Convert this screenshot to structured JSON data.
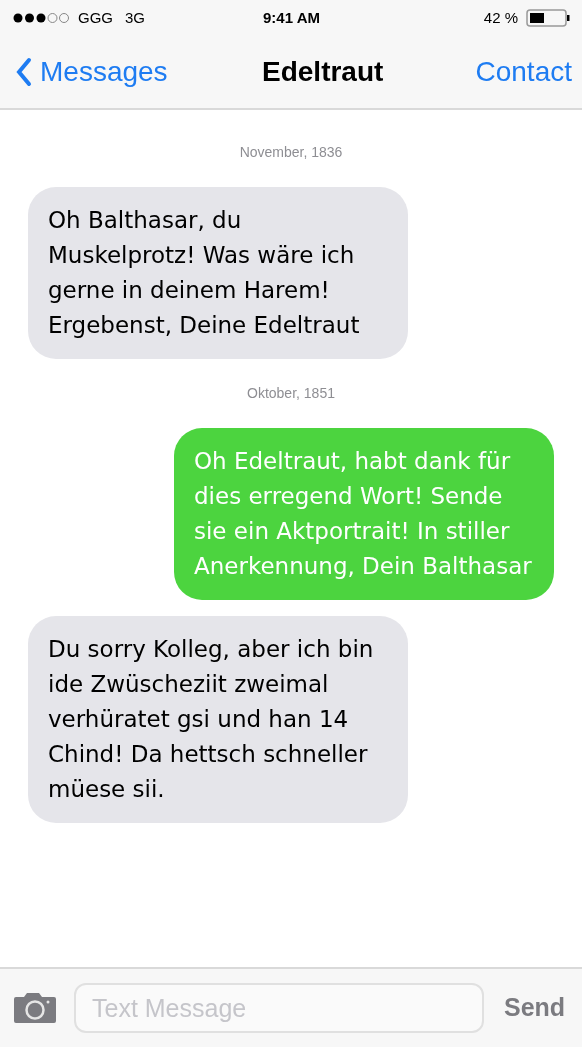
{
  "status_bar": {
    "carrier": "GGG",
    "network": "3G",
    "time": "9:41 AM",
    "battery": "42 %"
  },
  "nav": {
    "back": "Messages",
    "title": "Edeltraut",
    "action": "Contact"
  },
  "messages": [
    {
      "kind": "date",
      "text": "November, 1836"
    },
    {
      "kind": "incoming",
      "text": "Oh Balthasar, du Muskelprotz! Was wäre ich gerne in deinem Harem! Ergebenst, Deine Edeltraut"
    },
    {
      "kind": "date",
      "text": "Oktober, 1851"
    },
    {
      "kind": "outgoing",
      "text": "Oh Edeltraut, habt dank für dies erregend Wort! Sende sie ein Aktportrait! In stiller Anerkennung, Dein Balthasar"
    },
    {
      "kind": "incoming",
      "text": "Du sorry Kolleg, aber ich bin ide Zwüscheziit zweimal verhüratet gsi und han 14 Chind! Da hettsch schneller müese sii."
    }
  ],
  "composer": {
    "placeholder": "Text Message",
    "send": "Send"
  }
}
